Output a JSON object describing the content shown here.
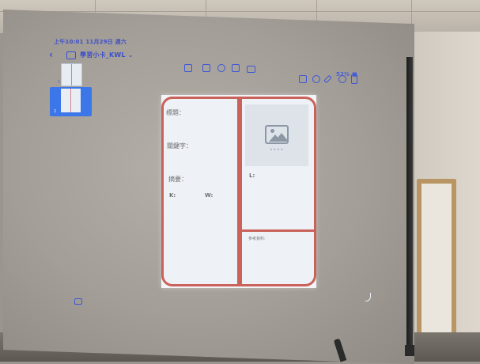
{
  "status": {
    "time": "上午10:01 11月29日 週六",
    "battery": "52% ■"
  },
  "document": {
    "title": "學習小卡_KWL ⌄"
  },
  "icons": {
    "back": "chevron-left-icon",
    "sidebar": "sidebar-icon",
    "image_placeholder": "image-icon"
  },
  "thumbnails": [
    {
      "number": "1"
    },
    {
      "number": "2"
    }
  ],
  "page": {
    "title_label": "標題：",
    "keywords_label": "關鍵字：",
    "summary_label": "摘要：",
    "k_label": "K:",
    "w_label": "W:",
    "l_label": "L:",
    "reference_label": "參考資料:",
    "image_dots": "••••"
  },
  "colors": {
    "ui_accent": "#3d57d8",
    "frame_border": "#c9625a",
    "selected_thumbnail": "#3b77e8"
  }
}
